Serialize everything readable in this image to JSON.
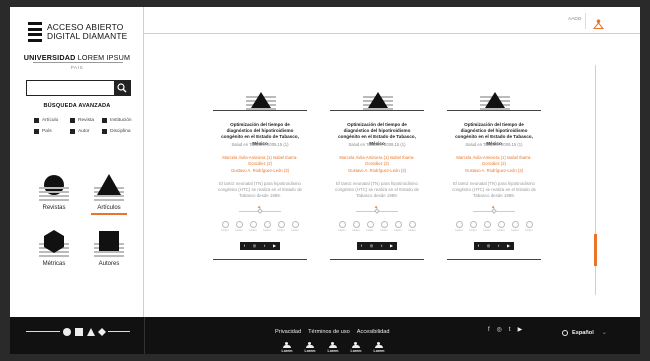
{
  "brand": {
    "logo_line1": "ACCESO ABIERTO",
    "logo_line2": "DIGITAL DIAMANTE",
    "university_bold": "UNIVERSIDAD",
    "university_light": "LOREM IPSUM",
    "country": "PAIS"
  },
  "search": {
    "placeholder": "",
    "value": ""
  },
  "advanced_search": {
    "title": "BÚSQUEDA AVANZADA",
    "filters": [
      {
        "label": "Artículo"
      },
      {
        "label": "Revista"
      },
      {
        "label": "Institución"
      },
      {
        "label": "País"
      },
      {
        "label": "Autor"
      },
      {
        "label": "Disciplina"
      }
    ]
  },
  "categories": [
    {
      "label": "Revistas",
      "icon": "circle-stripes-icon"
    },
    {
      "label": "Artículos",
      "icon": "triangle-stripes-icon",
      "active": true
    },
    {
      "label": "Métricas",
      "icon": "hexagon-stripes-icon"
    },
    {
      "label": "Autores",
      "icon": "square-stripes-icon"
    }
  ],
  "topbar": {
    "login_text": "AADD",
    "account_icon": "user-triangle-icon"
  },
  "cards": [
    {
      "title": "Optimización del tiempo de diagnóstico del hipotiroidismo congénito en el Estado de Tabasco, México",
      "meta": "Salud en Tabasco, 2009,15 (1)",
      "authors_line1": "Marcela Ávila-Aminiera (1) Isabel Ibarra-González (2)",
      "authors_line2": "Gustavo A. Rodríguez-León (3)",
      "abstract": "El tamiz neonatal (TN) para hipotiroidismo congénito (HTC) se realiza en el Estado de Tabasco desde 1989.",
      "metrics": [
        "Lorem",
        "Lorem",
        "Lorem",
        "Lorem",
        "Lorem",
        "Lorem"
      ],
      "share": [
        "f",
        "◎",
        "t",
        "▶"
      ]
    },
    {
      "title": "Optimización del tiempo de diagnóstico del hipotiroidismo congénito en el Estado de Tabasco, México",
      "meta": "Salud en Tabasco, 2009,15 (1)",
      "authors_line1": "Marcela Ávila-Aminiera (1) Isabel Ibarra-González (2)",
      "authors_line2": "Gustavo A. Rodríguez-León (3)",
      "abstract": "El tamiz neonatal (TN) para hipotiroidismo congénito (HTC) se realiza en el Estado de Tabasco desde 1989.",
      "metrics": [
        "Lorem",
        "Lorem",
        "Lorem",
        "Lorem",
        "Lorem",
        "Lorem"
      ],
      "share": [
        "f",
        "◎",
        "t",
        "▶"
      ]
    },
    {
      "title": "Optimización del tiempo de diagnóstico del hipotiroidismo congénito en el Estado de Tabasco, México",
      "meta": "Salud en Tabasco, 2009,15 (1)",
      "authors_line1": "Marcela Ávila-Aminiera (1) Isabel Ibarra-González (2)",
      "authors_line2": "Gustavo A. Rodríguez-León (3)",
      "abstract": "El tamiz neonatal (TN) para hipotiroidismo congénito (HTC) se realiza en el Estado de Tabasco desde 1989.",
      "metrics": [
        "Lorem",
        "Lorem",
        "Lorem",
        "Lorem",
        "Lorem",
        "Lorem"
      ],
      "share": [
        "f",
        "◎",
        "t",
        "▶"
      ]
    }
  ],
  "footer": {
    "links": [
      "Privacidad",
      "Términos de uso",
      "Accesibilidad"
    ],
    "social": [
      "f",
      "◎",
      "t",
      "▶"
    ],
    "language": "Español",
    "logos": [
      "Lorem",
      "Lorem",
      "Lorem",
      "Lorem",
      "Lorem"
    ]
  },
  "colors": {
    "accent": "#e8752a",
    "dark": "#111111",
    "rule": "#cfcfcf"
  }
}
